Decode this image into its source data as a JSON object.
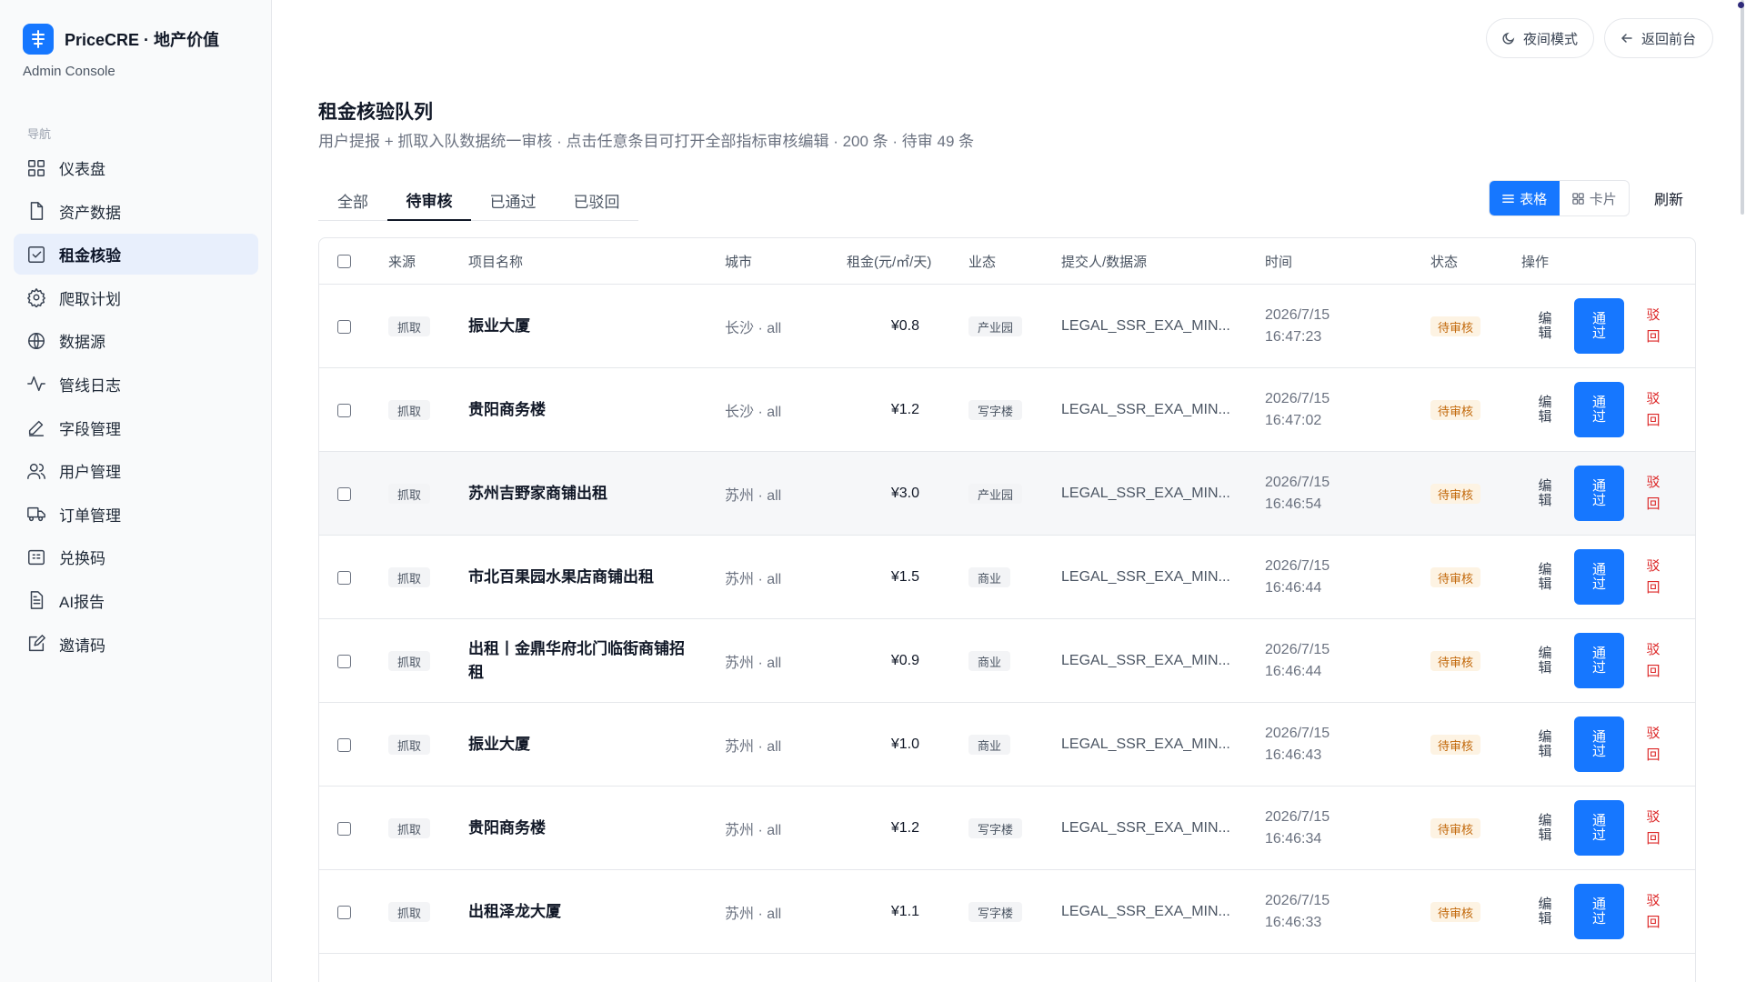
{
  "brand": {
    "name": "PriceCRE · 地产价值",
    "subtitle": "Admin Console"
  },
  "nav": {
    "heading": "导航",
    "items": [
      {
        "label": "仪表盘",
        "icon": "grid-icon",
        "active": false
      },
      {
        "label": "资产数据",
        "icon": "file-icon",
        "active": false
      },
      {
        "label": "租金核验",
        "icon": "check-square-icon",
        "active": true
      },
      {
        "label": "爬取计划",
        "icon": "gear-icon",
        "active": false
      },
      {
        "label": "数据源",
        "icon": "globe-icon",
        "active": false
      },
      {
        "label": "管线日志",
        "icon": "activity-icon",
        "active": false
      },
      {
        "label": "字段管理",
        "icon": "pen-icon",
        "active": false
      },
      {
        "label": "用户管理",
        "icon": "users-icon",
        "active": false
      },
      {
        "label": "订单管理",
        "icon": "truck-icon",
        "active": false
      },
      {
        "label": "兑换码",
        "icon": "ticket-icon",
        "active": false
      },
      {
        "label": "AI报告",
        "icon": "document-icon",
        "active": false
      },
      {
        "label": "邀请码",
        "icon": "edit-square-icon",
        "active": false
      }
    ]
  },
  "topbar": {
    "night_mode": "夜间模式",
    "back": "返回前台"
  },
  "header": {
    "title": "租金核验队列",
    "subtitle": "用户提报 + 抓取入队数据统一审核 · 点击任意条目可打开全部指标审核编辑 · 200 条 · 待审 49 条"
  },
  "tabs": [
    "全部",
    "待审核",
    "已通过",
    "已驳回"
  ],
  "active_tab": 1,
  "view": {
    "table": "表格",
    "card": "卡片",
    "refresh": "刷新"
  },
  "table": {
    "columns": [
      "来源",
      "项目名称",
      "城市",
      "租金(元/㎡/天)",
      "业态",
      "提交人/数据源",
      "时间",
      "状态",
      "操作"
    ],
    "rows": [
      {
        "source": "抓取",
        "name": "振业大厦",
        "city": "长沙 · all",
        "rent": "¥0.8",
        "type": "产业园",
        "submitter": "LEGAL_SSR_EXA_MIN...",
        "date": "2026/7/15",
        "clock": "16:47:23",
        "status": "待审核",
        "edit": "编辑",
        "pass": "通过",
        "reject": "驳回"
      },
      {
        "source": "抓取",
        "name": "贵阳商务楼",
        "city": "长沙 · all",
        "rent": "¥1.2",
        "type": "写字楼",
        "submitter": "LEGAL_SSR_EXA_MIN...",
        "date": "2026/7/15",
        "clock": "16:47:02",
        "status": "待审核",
        "edit": "编辑",
        "pass": "通过",
        "reject": "驳回"
      },
      {
        "source": "抓取",
        "name": "苏州吉野家商铺出租",
        "city": "苏州 · all",
        "rent": "¥3.0",
        "type": "产业园",
        "submitter": "LEGAL_SSR_EXA_MIN...",
        "date": "2026/7/15",
        "clock": "16:46:54",
        "status": "待审核",
        "edit": "编辑",
        "pass": "通过",
        "reject": "驳回"
      },
      {
        "source": "抓取",
        "name": "市北百果园水果店商铺出租",
        "city": "苏州 · all",
        "rent": "¥1.5",
        "type": "商业",
        "submitter": "LEGAL_SSR_EXA_MIN...",
        "date": "2026/7/15",
        "clock": "16:46:44",
        "status": "待审核",
        "edit": "编辑",
        "pass": "通过",
        "reject": "驳回"
      },
      {
        "source": "抓取",
        "name": "出租丨金鼎华府北门临街商铺招租",
        "city": "苏州 · all",
        "rent": "¥0.9",
        "type": "商业",
        "submitter": "LEGAL_SSR_EXA_MIN...",
        "date": "2026/7/15",
        "clock": "16:46:44",
        "status": "待审核",
        "edit": "编辑",
        "pass": "通过",
        "reject": "驳回"
      },
      {
        "source": "抓取",
        "name": "振业大厦",
        "city": "苏州 · all",
        "rent": "¥1.0",
        "type": "商业",
        "submitter": "LEGAL_SSR_EXA_MIN...",
        "date": "2026/7/15",
        "clock": "16:46:43",
        "status": "待审核",
        "edit": "编辑",
        "pass": "通过",
        "reject": "驳回"
      },
      {
        "source": "抓取",
        "name": "贵阳商务楼",
        "city": "苏州 · all",
        "rent": "¥1.2",
        "type": "写字楼",
        "submitter": "LEGAL_SSR_EXA_MIN...",
        "date": "2026/7/15",
        "clock": "16:46:34",
        "status": "待审核",
        "edit": "编辑",
        "pass": "通过",
        "reject": "驳回"
      },
      {
        "source": "抓取",
        "name": "出租泽龙大厦",
        "city": "苏州 · all",
        "rent": "¥1.1",
        "type": "写字楼",
        "submitter": "LEGAL_SSR_EXA_MIN...",
        "date": "2026/7/15",
        "clock": "16:46:33",
        "status": "待审核",
        "edit": "编辑",
        "pass": "通过",
        "reject": "驳回"
      }
    ]
  },
  "colors": {
    "accent": "#1677ff",
    "reject": "#dc2626",
    "pending_text": "#c2680a",
    "pending_bg": "#fdf3e3",
    "active_nav": "#e8effc"
  }
}
